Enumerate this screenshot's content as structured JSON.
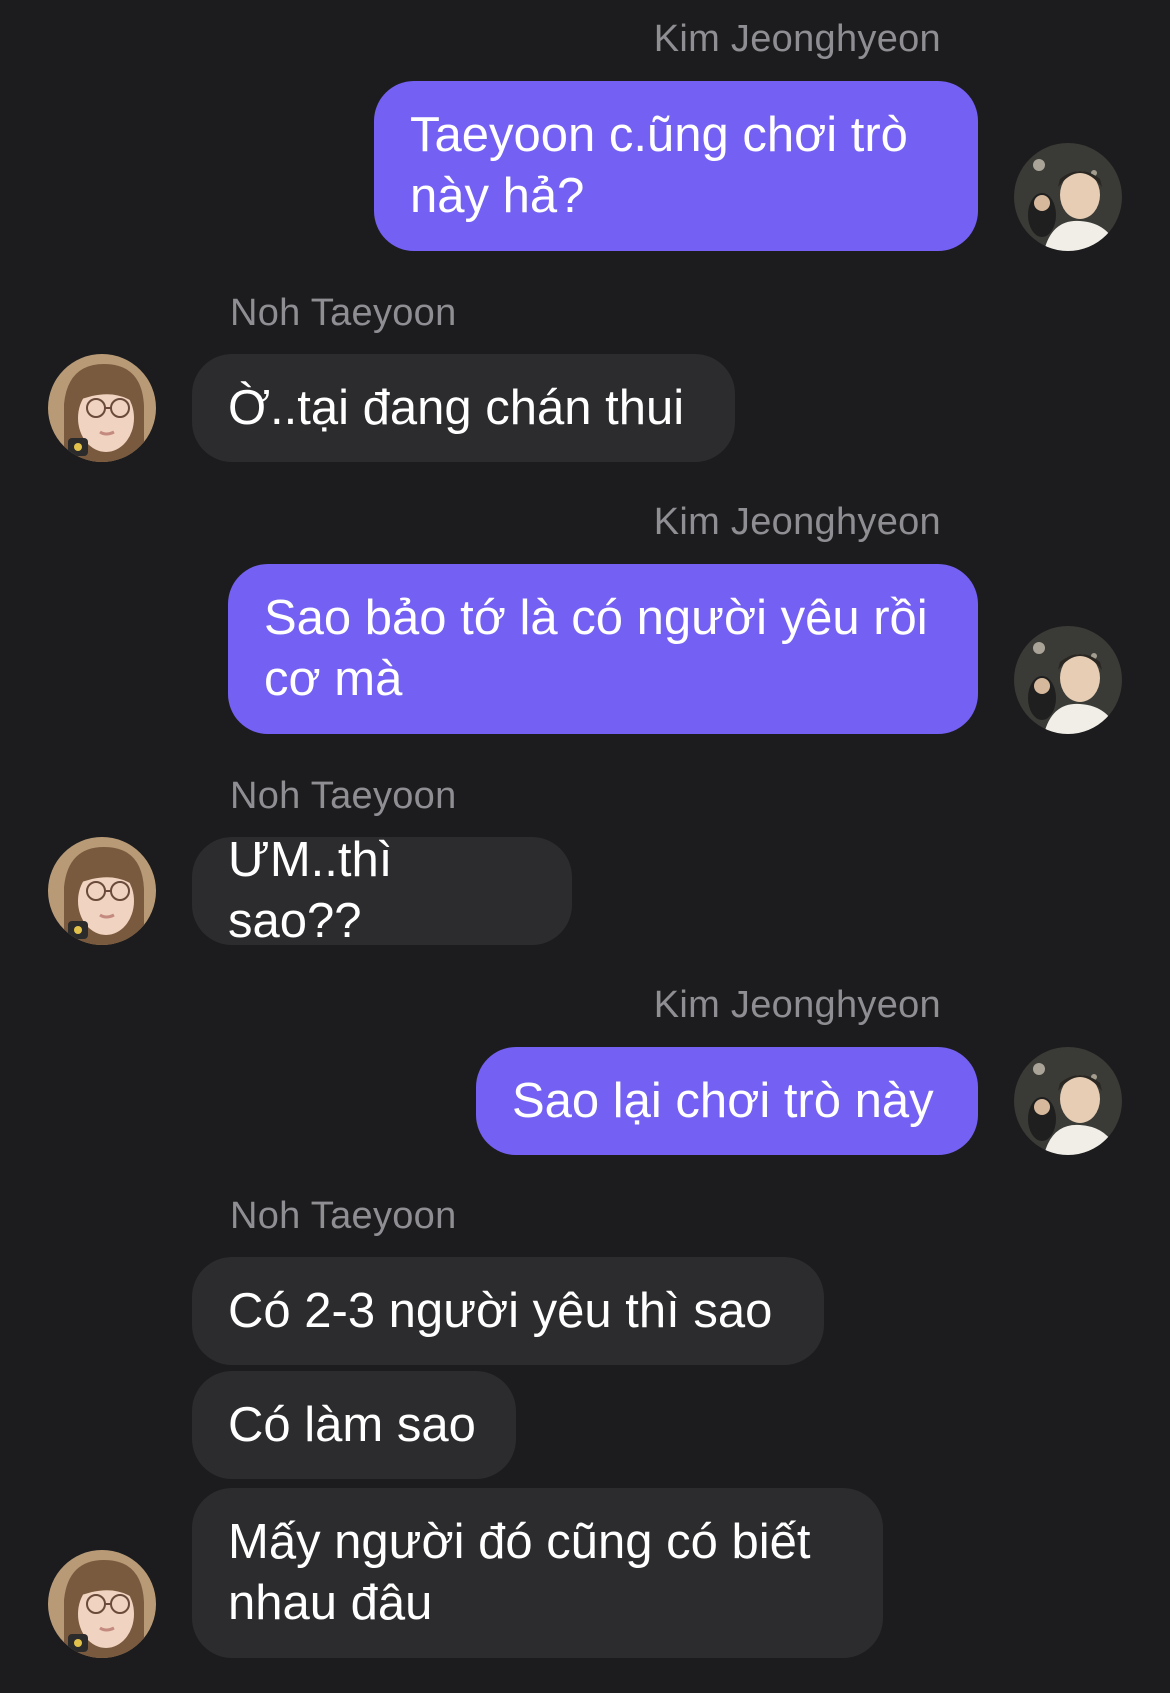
{
  "messages": [
    {
      "sender": "Kim Jeonghyeon",
      "side": "out",
      "text": "Taeyoon c.ũng chơi trò này hả?"
    },
    {
      "sender": "Noh Taeyoon",
      "side": "in",
      "text": "Ờ..tại đang chán thui"
    },
    {
      "sender": "Kim Jeonghyeon",
      "side": "out",
      "text": "Sao bảo tớ là có người yêu rồi cơ mà"
    },
    {
      "sender": "Noh Taeyoon",
      "side": "in",
      "text": "ƯM..thì sao??"
    },
    {
      "sender": "Kim Jeonghyeon",
      "side": "out",
      "text": "Sao lại chơi trò này"
    },
    {
      "sender": "Noh Taeyoon",
      "side": "in",
      "text": "Có 2-3 người yêu thì sao"
    },
    {
      "sender": "Noh Taeyoon",
      "side": "in",
      "text": "Có làm sao"
    },
    {
      "sender": "Noh Taeyoon",
      "side": "in",
      "text": "Mấy người đó cũng có biết nhau đâu"
    }
  ],
  "colors": {
    "background": "#1c1c1e",
    "outgoing_bubble": "#7461f3",
    "incoming_bubble": "#2c2c2e",
    "sender_name": "#8e8e93"
  }
}
